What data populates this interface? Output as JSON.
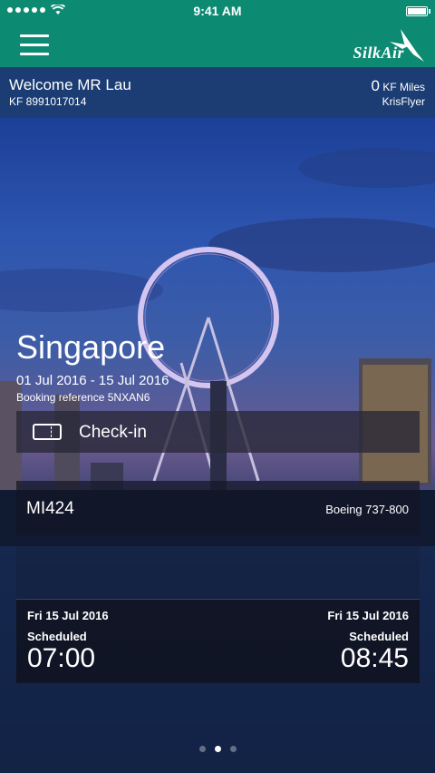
{
  "status_bar": {
    "time": "9:41 AM"
  },
  "header": {
    "logo_text": "SilkAir"
  },
  "member": {
    "welcome": "Welcome MR Lau",
    "kf_number": "KF 8991017014",
    "miles_value": "0",
    "miles_unit": "KF Miles",
    "program": "KrisFlyer"
  },
  "trip": {
    "city": "Singapore",
    "dates": "01 Jul 2016 - 15 Jul 2016",
    "booking_ref": "Booking reference 5NXAN6",
    "checkin_label": "Check-in"
  },
  "flight": {
    "number": "MI424",
    "aircraft": "Boeing 737-800",
    "departure": {
      "date": "Fri 15 Jul 2016",
      "status": "Scheduled",
      "time": "07:00"
    },
    "arrival": {
      "date": "Fri 15 Jul 2016",
      "status": "Scheduled",
      "time": "08:45"
    }
  },
  "pager": {
    "pages": 3,
    "active": 2
  },
  "colors": {
    "header": "#0c8a72",
    "member_bar": "#1b3d73"
  }
}
